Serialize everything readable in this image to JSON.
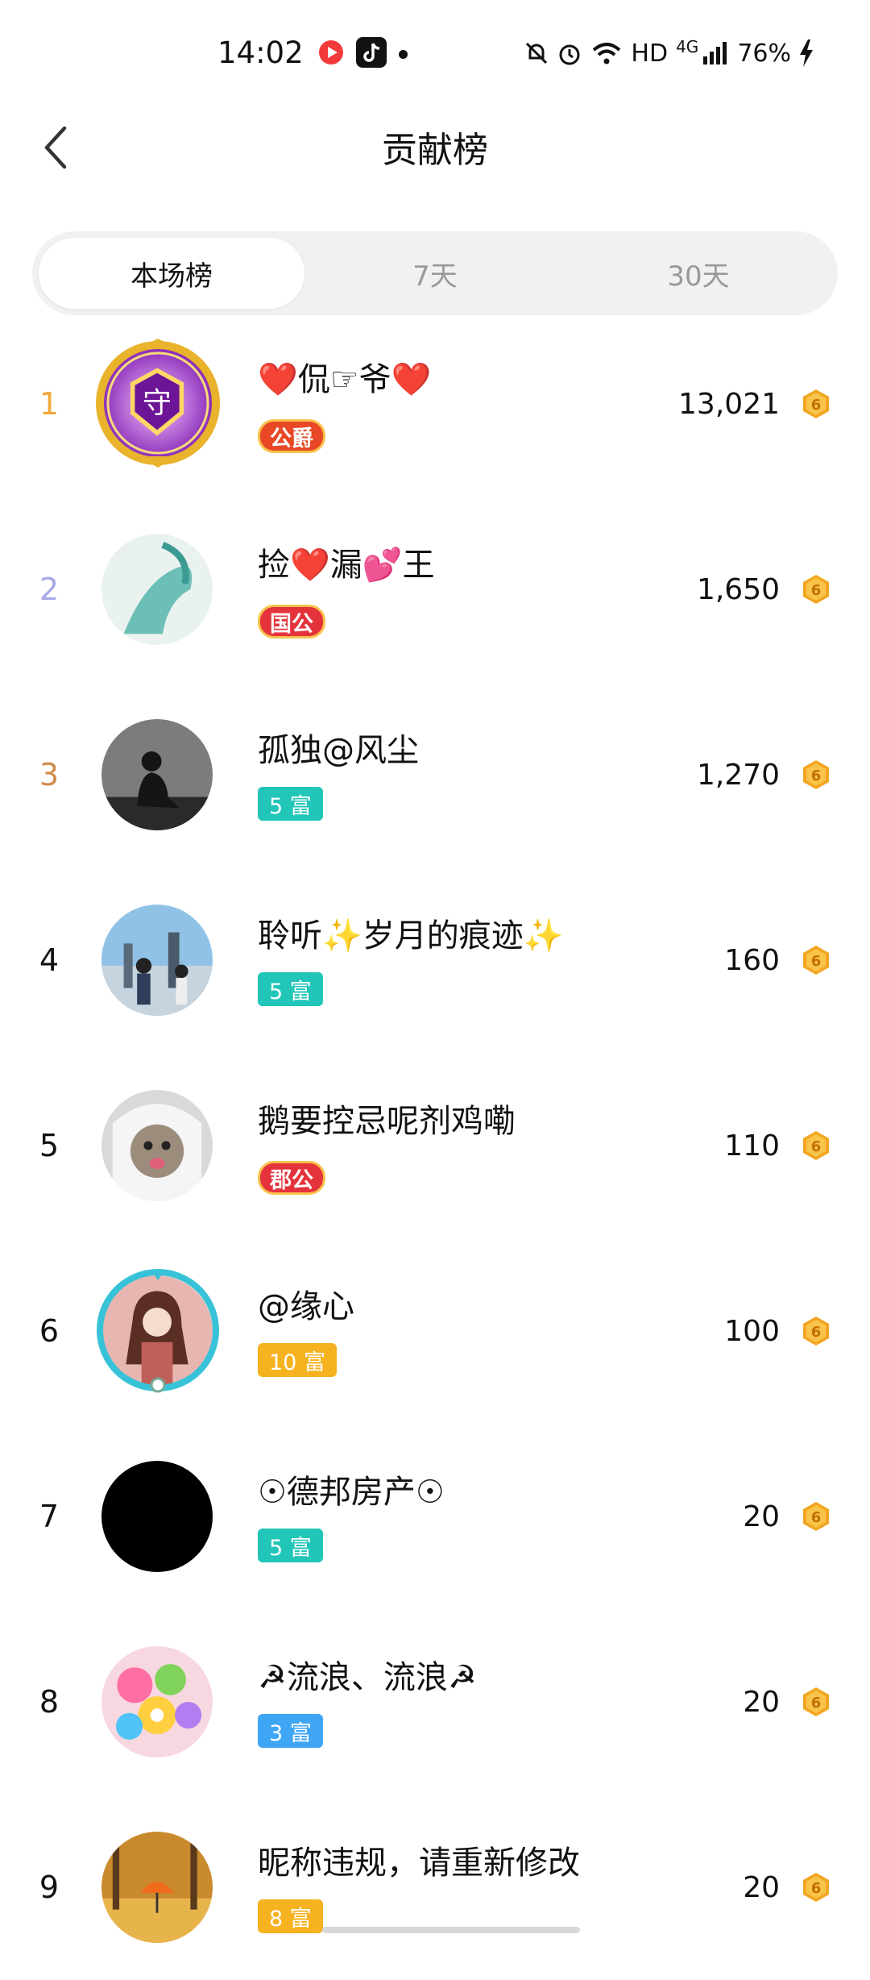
{
  "status": {
    "time": "14:02",
    "network": "HD",
    "signal": "4G",
    "battery": "76%"
  },
  "header": {
    "title": "贡献榜"
  },
  "tabs": [
    {
      "label": "本场榜",
      "active": true
    },
    {
      "label": "7天",
      "active": false
    },
    {
      "label": "30天",
      "active": false
    }
  ],
  "colors": {
    "rank1": "#f2a93b",
    "rank2": "#a6a8e6",
    "rank3": "#cf8b4a",
    "teal_badge": "#22c6b8",
    "gold_badge": "#f6b21f",
    "blue_badge": "#3fa6f5"
  },
  "list": [
    {
      "rank": "1",
      "name": "❤️侃☞爷❤️",
      "badge": "公爵",
      "badge_style": "noble",
      "score": "13,021"
    },
    {
      "rank": "2",
      "name": "捡❤️漏💕王",
      "badge": "国公",
      "badge_style": "noble-red",
      "score": "1,650"
    },
    {
      "rank": "3",
      "name": "孤独@风尘",
      "badge": "5 富",
      "badge_style": "teal",
      "score": "1,270"
    },
    {
      "rank": "4",
      "name": "聆听✨岁月的痕迹✨",
      "badge": "5 富",
      "badge_style": "teal",
      "score": "160"
    },
    {
      "rank": "5",
      "name": "鹅要控忌呢剂鸡嘞",
      "badge": "郡公",
      "badge_style": "noble-red",
      "score": "110"
    },
    {
      "rank": "6",
      "name": "@缘心",
      "badge": "10 富",
      "badge_style": "gold",
      "score": "100"
    },
    {
      "rank": "7",
      "name": "☉德邦房产☉",
      "badge": "5 富",
      "badge_style": "teal",
      "score": "20"
    },
    {
      "rank": "8",
      "name": "☭流浪、流浪☭",
      "badge": "3 富",
      "badge_style": "blue",
      "score": "20"
    },
    {
      "rank": "9",
      "name": "昵称违规，请重新修改",
      "badge": "8 富",
      "badge_style": "gold",
      "score": "20"
    }
  ]
}
